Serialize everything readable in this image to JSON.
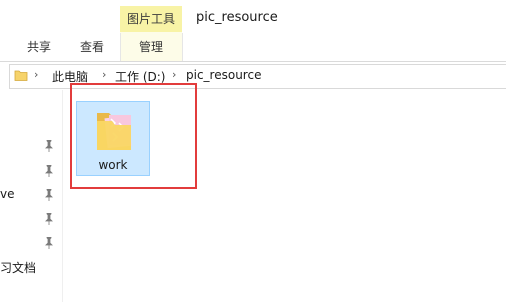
{
  "ribbon": {
    "context_tab_label": "图片工具",
    "window_title": "pic_resource",
    "tabs": [
      "共享",
      "查看",
      "管理"
    ]
  },
  "address": {
    "crumbs": [
      "此电脑",
      "工作 (D:)",
      "pic_resource"
    ]
  },
  "nav": {
    "partial_items": [
      "ve",
      "习文档"
    ]
  },
  "content": {
    "items": [
      {
        "name": "work",
        "icon": "folder-with-images-icon"
      }
    ]
  },
  "colors": {
    "selection_fill": "#cce8ff",
    "selection_border": "#99d1ff",
    "highlight_border": "#e23c3c",
    "context_tab_bg": "#f8f3a6"
  }
}
